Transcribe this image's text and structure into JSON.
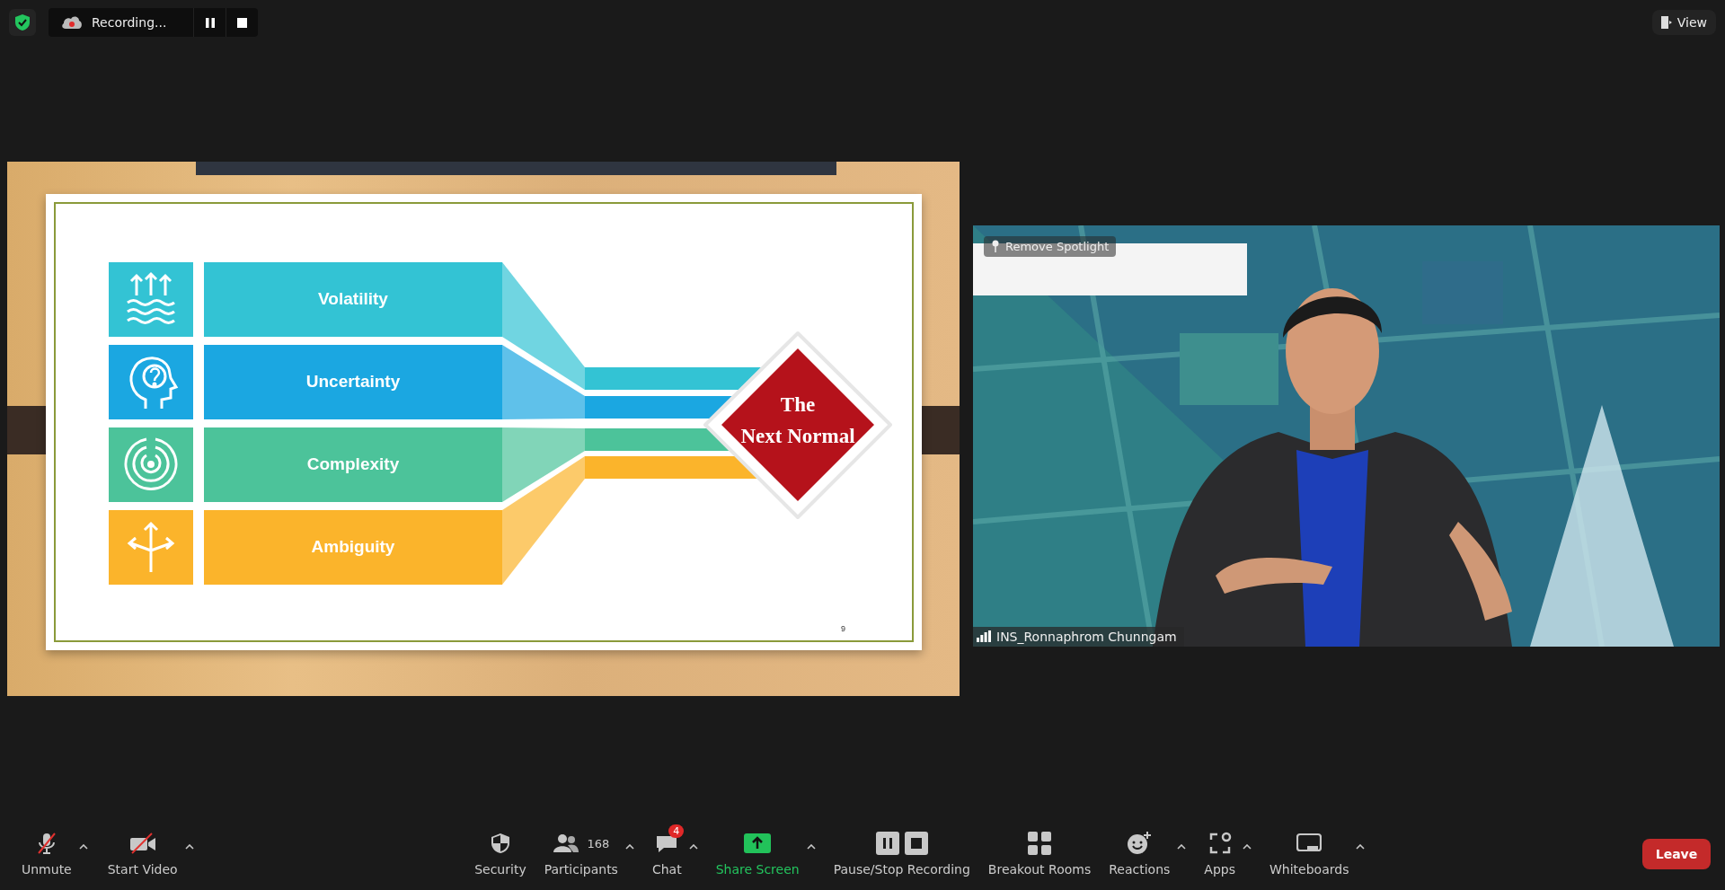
{
  "top_bar": {
    "recording_label": "Recording...",
    "view_button": "View"
  },
  "shared_screen": {
    "slide": {
      "rows": [
        {
          "kind": "volatility",
          "label": "Volatility",
          "color": "#33c3d4"
        },
        {
          "kind": "uncertainty",
          "label": "Uncertainty",
          "color": "#1ba7e1"
        },
        {
          "kind": "complexity",
          "label": "Complexity",
          "color": "#4cc39a"
        },
        {
          "kind": "ambiguity",
          "label": "Ambiguity",
          "color": "#fbb42b"
        }
      ],
      "center_lines": [
        "The",
        "Next Normal"
      ],
      "page_number": "9"
    }
  },
  "video": {
    "spotlight_button": "Remove Spotlight",
    "participant_name": "INS_Ronnaphrom Chunngam"
  },
  "toolbar": {
    "left_items": [
      {
        "kind": "mic",
        "label": "Unmute",
        "menu": true
      },
      {
        "kind": "video",
        "label": "Start Video",
        "menu": true
      }
    ],
    "center_items": [
      {
        "kind": "security",
        "label": "Security",
        "menu": false
      },
      {
        "kind": "participants",
        "label": "Participants",
        "count": "168",
        "menu": true
      },
      {
        "kind": "chat",
        "label": "Chat",
        "badge": "4",
        "menu": true
      },
      {
        "kind": "share",
        "label": "Share Screen",
        "menu": true
      },
      {
        "kind": "recording",
        "label": "Pause/Stop Recording",
        "menu": false
      },
      {
        "kind": "breakout",
        "label": "Breakout Rooms",
        "menu": false
      },
      {
        "kind": "reactions",
        "label": "Reactions",
        "menu": true
      },
      {
        "kind": "apps",
        "label": "Apps",
        "menu": true
      },
      {
        "kind": "whiteboards",
        "label": "Whiteboards",
        "menu": true
      }
    ],
    "leave_button": "Leave"
  }
}
